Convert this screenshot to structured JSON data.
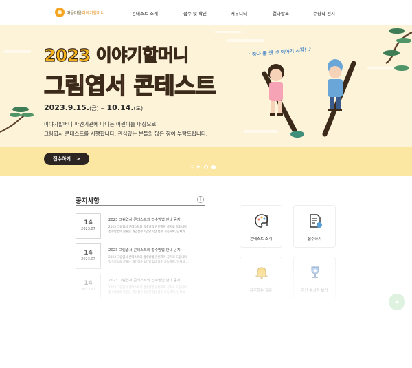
{
  "header": {
    "logo_prefix": "마음마음",
    "logo_main": "이야기할머니",
    "nav": [
      {
        "label": "콘테스트 소개"
      },
      {
        "label": "접수 및 확인"
      },
      {
        "label": "커뮤니티"
      },
      {
        "label": "결과발표"
      },
      {
        "label": "수상작 전시"
      }
    ]
  },
  "hero": {
    "title_line1": "2023 이야기할머니",
    "title_line2a": "그림엽서",
    "title_line2b": "콘테스트",
    "date_start": "2023.9.15.",
    "date_start_day": "(금)",
    "date_sep": " ~ ",
    "date_end": "10.14.",
    "date_end_day": "(토)",
    "desc_line1": "이야기할머니 파견기관에 다니는 어린이를 대상으로",
    "desc_line2": "그림엽서 콘테스트를 시행합니다. 관심있는 분들의 많은 참여 부탁드립니다.",
    "apply_label": "접수하기",
    "apply_arrow": ">",
    "kids_text": "♪ 하나 둘 셋 넷 이야기 시작! ♪",
    "slider": {
      "prev": "<",
      "play": "▶",
      "total_dots": 2,
      "active_dot": 2
    }
  },
  "notices": {
    "title": "공지사항",
    "more": "+",
    "items": [
      {
        "day": "14",
        "month": "2023.07",
        "title": "2023 그림엽서 콘테스트의 접수방법 안내 공지",
        "body1": "2023 그림엽서 콘테스트의 접수방법 관련하여 공지로 드립니다.",
        "body2": "접수방법의 분류는 개인접수 1인당 1장 접수 가능하며, 단체의 ..."
      },
      {
        "day": "14",
        "month": "2023.07",
        "title": "2023 그림엽서 콘테스트의 접수방법 안내 공지",
        "body1": "2023 그림엽서 콘테스트의 접수방법 관련하여 공지로 드립니다.",
        "body2": "접수방법의 분류는 개인접수 1인당 1장 접수 가능하며, 단체의 ..."
      },
      {
        "day": "14",
        "month": "2023.07",
        "title": "2023 그림엽서 콘테스트의 접수방법 안내 공지",
        "body1": "2023 그림엽서 콘테스트의 접수방법 관련하여 공지로 드립니다.",
        "body2": "접수방법의 분류는 개인접수 1인당 1장 접수 가능하며, 단체의 ..."
      }
    ]
  },
  "quick_menu": [
    {
      "label": "콘테스트 소개",
      "icon": "palette-icon"
    },
    {
      "label": "접수하기",
      "icon": "document-clock-icon"
    },
    {
      "label": "자주하는 질문",
      "icon": "bell-icon"
    },
    {
      "label": "지난 수상작 보기",
      "icon": "trophy-icon"
    }
  ],
  "colors": {
    "hero_bg": "#fcf3d9",
    "hero_band": "#fbe6a2",
    "title1": "#f6b21b",
    "title2": "#f0808f",
    "title2_accent": "#7fc58a",
    "button": "#2b2420"
  }
}
